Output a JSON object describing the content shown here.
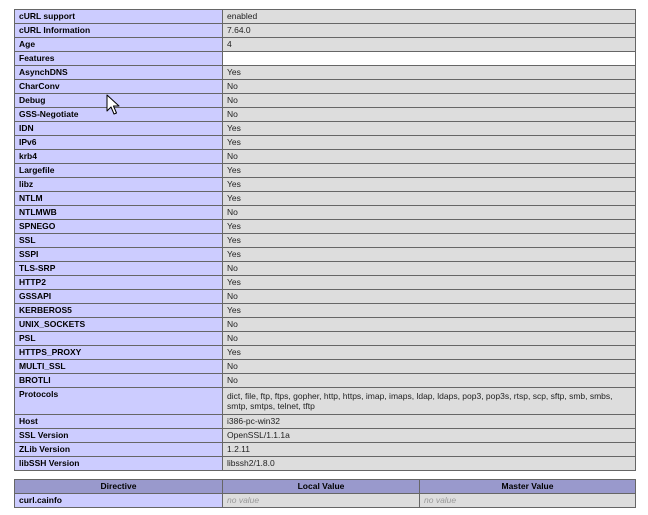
{
  "main_table": {
    "rows": [
      {
        "label": "cURL support",
        "value": "enabled"
      },
      {
        "label": "cURL Information",
        "value": "7.64.0"
      },
      {
        "label": "Age",
        "value": "4"
      },
      {
        "label": "Features",
        "value": ""
      },
      {
        "label": "AsynchDNS",
        "value": "Yes"
      },
      {
        "label": "CharConv",
        "value": "No"
      },
      {
        "label": "Debug",
        "value": "No"
      },
      {
        "label": "GSS-Negotiate",
        "value": "No"
      },
      {
        "label": "IDN",
        "value": "Yes"
      },
      {
        "label": "IPv6",
        "value": "Yes"
      },
      {
        "label": "krb4",
        "value": "No"
      },
      {
        "label": "Largefile",
        "value": "Yes"
      },
      {
        "label": "libz",
        "value": "Yes"
      },
      {
        "label": "NTLM",
        "value": "Yes"
      },
      {
        "label": "NTLMWB",
        "value": "No"
      },
      {
        "label": "SPNEGO",
        "value": "Yes"
      },
      {
        "label": "SSL",
        "value": "Yes"
      },
      {
        "label": "SSPI",
        "value": "Yes"
      },
      {
        "label": "TLS-SRP",
        "value": "No"
      },
      {
        "label": "HTTP2",
        "value": "Yes"
      },
      {
        "label": "GSSAPI",
        "value": "No"
      },
      {
        "label": "KERBEROS5",
        "value": "Yes"
      },
      {
        "label": "UNIX_SOCKETS",
        "value": "No"
      },
      {
        "label": "PSL",
        "value": "No"
      },
      {
        "label": "HTTPS_PROXY",
        "value": "Yes"
      },
      {
        "label": "MULTI_SSL",
        "value": "No"
      },
      {
        "label": "BROTLI",
        "value": "No"
      },
      {
        "label": "Protocols",
        "value": "dict, file, ftp, ftps, gopher, http, https, imap, imaps, ldap, ldaps, pop3, pop3s, rtsp, scp, sftp, smb, smbs, smtp, smtps, telnet, tftp"
      },
      {
        "label": "Host",
        "value": "i386-pc-win32"
      },
      {
        "label": "SSL Version",
        "value": "OpenSSL/1.1.1a"
      },
      {
        "label": "ZLib Version",
        "value": "1.2.11"
      },
      {
        "label": "libSSH Version",
        "value": "libssh2/1.8.0"
      }
    ]
  },
  "directive_table": {
    "headers": {
      "directive": "Directive",
      "local": "Local Value",
      "master": "Master Value"
    },
    "rows": [
      {
        "directive": "curl.cainfo",
        "local": "no value",
        "master": "no value"
      }
    ]
  },
  "colors": {
    "label_bg": "#ccccff",
    "value_bg": "#dddddd",
    "header_bg": "#9999cc",
    "border": "#666666"
  },
  "icons": {
    "cursor": "mouse-pointer-icon"
  }
}
